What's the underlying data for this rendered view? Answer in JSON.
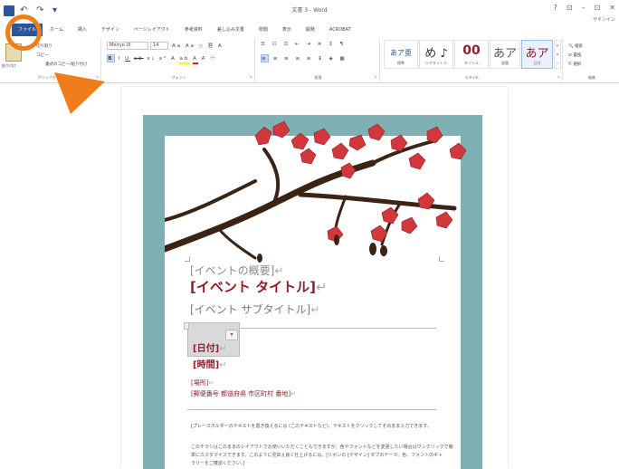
{
  "window": {
    "title": "文書 3 - Word",
    "controls": [
      "?",
      "⊡",
      "–",
      "⊡",
      "✕"
    ],
    "signin": "サインイン"
  },
  "tabs": [
    {
      "label": "ファイル"
    },
    {
      "label": "ホーム"
    },
    {
      "label": "挿入"
    },
    {
      "label": "デザイン"
    },
    {
      "label": "ページレイアウト"
    },
    {
      "label": "参考資料"
    },
    {
      "label": "差し込み文書"
    },
    {
      "label": "校閲"
    },
    {
      "label": "表示"
    },
    {
      "label": "開発"
    },
    {
      "label": "ACROBAT"
    }
  ],
  "ribbon": {
    "clipboard": {
      "paste_label": "貼り付け",
      "cut_label": "切り取り",
      "copy_label": "コピー",
      "format_painter_label": "書式のコピー/貼り付け",
      "group_label": "クリップボード"
    },
    "font": {
      "font_name": "Meiryo UI",
      "font_size": "14",
      "group_label": "フォント"
    },
    "paragraph": {
      "group_label": "段落"
    },
    "styles": {
      "items": [
        {
          "preview": "あア亜",
          "name": "標準"
        },
        {
          "preview": "め ♪",
          "name": "ツアタイトル"
        },
        {
          "preview": "00",
          "name": "タイトル"
        },
        {
          "preview": "あア",
          "name": "副題"
        },
        {
          "preview": "あア",
          "name": "日付"
        }
      ],
      "group_label": "スタイル"
    },
    "editing": {
      "find_label": "検索",
      "replace_label": "置換",
      "select_label": "選択",
      "group_label": "編集"
    }
  },
  "document": {
    "summary": "[イベントの概要]",
    "title": "[イベント タイトル]",
    "subtitle": "[イベント サブタイトル]",
    "date": "[日付]",
    "time": "[時間]",
    "place": "[場所]",
    "address": "[郵便番号 都道府県 市区町村 番地]",
    "body_1": "[プレースホルダーのテキストを置き換えるには (このテキストなど)、テキストをクリックしてそのまま入力できます。",
    "body_2": "このチラシはこのままのレイアウトでお使いいただくこともできますが、色やフォントなどを変更したい場合はワンクリックで簡",
    "body_3": "単にカスタマイズできます。このように見栄え良く仕上げるには、[リボンの [デザイン] タブのテーマ、色、フォントのギャ",
    "body_4": "ラリーをご確認ください。]",
    "paragraph_mark": "↵"
  },
  "colors": {
    "accent": "#2b579a",
    "poster_frame": "#7fb0b4",
    "title_red": "#8e1e2a",
    "annotation": "#ef7d1a",
    "blossom": "#d2373c",
    "branch": "#3b2414"
  }
}
